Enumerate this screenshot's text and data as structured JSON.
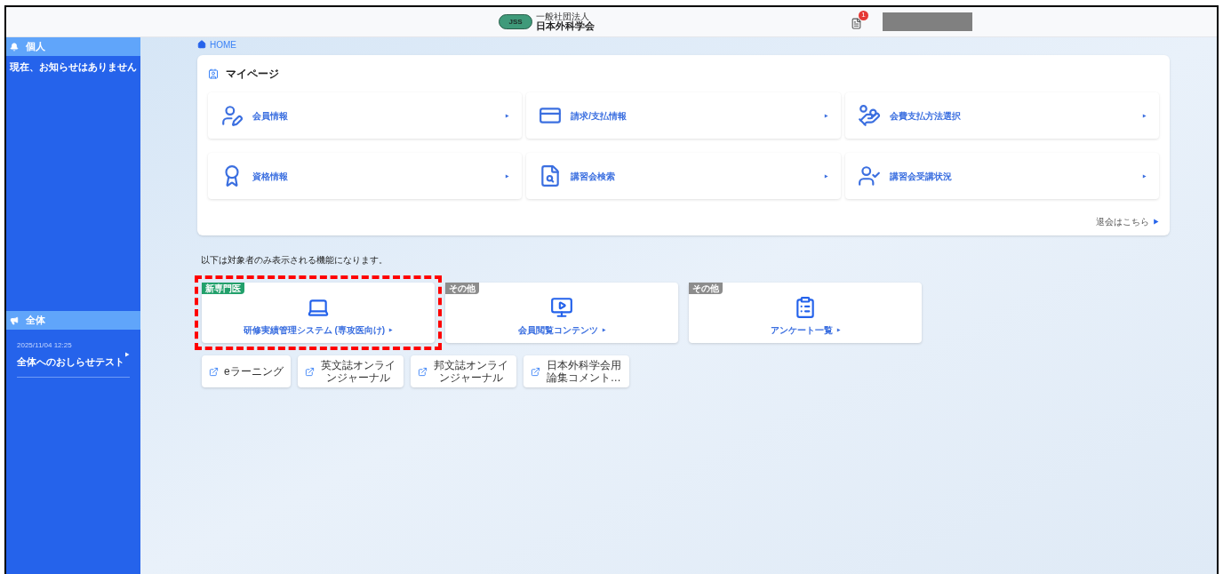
{
  "header": {
    "logo_mark": "JSS",
    "logo_subtitle": "一般社団法人",
    "logo_title": "日本外科学会",
    "notification_count": "1"
  },
  "sidebar": {
    "sections": [
      {
        "title": "個人",
        "items": [
          {
            "kind": "message",
            "text": "現在、お知らせはありません"
          }
        ]
      },
      {
        "title": "全体",
        "items": [
          {
            "kind": "notice",
            "date": "2025/11/04 12:25",
            "text": "全体へのおしらせテスト"
          }
        ]
      }
    ]
  },
  "breadcrumb": "HOME",
  "mypage": {
    "title": "マイページ",
    "items": [
      {
        "label": "会員情報"
      },
      {
        "label": "請求/支払情報"
      },
      {
        "label": "会費支払方法選択"
      },
      {
        "label": "資格情報"
      },
      {
        "label": "講習会検索"
      },
      {
        "label": "講習会受講状況"
      }
    ],
    "withdraw_link": "退会はこちら"
  },
  "notice": "以下は対象者のみ表示される機能になります。",
  "features": [
    {
      "tag": "新専門医",
      "color": "#22a06b",
      "label": "研修実績管理システム (専攻医向け)",
      "highlighted": true
    },
    {
      "tag": "その他",
      "color": "#8c8c8c",
      "label": "会員閲覧コンテンツ",
      "highlighted": false
    },
    {
      "tag": "その他",
      "color": "#8c8c8c",
      "label": "アンケート一覧",
      "highlighted": false
    }
  ],
  "links": [
    {
      "label": "eラーニング"
    },
    {
      "label": "英文誌オンラインジャーナル"
    },
    {
      "label": "邦文誌オンラインジャーナル"
    },
    {
      "label": "日本外科学会用論集コメント…"
    }
  ]
}
